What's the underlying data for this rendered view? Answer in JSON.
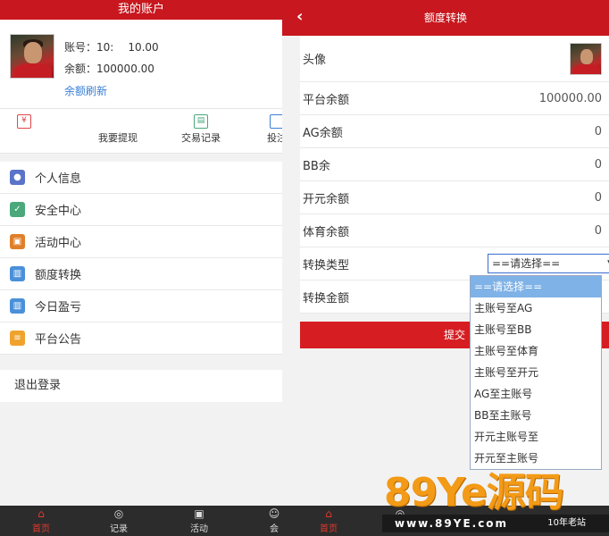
{
  "colors": {
    "brand_red": "#c8171e",
    "link_blue": "#3a7fd5",
    "footer_dark": "#2c2c2c",
    "dropdown_highlight": "#7fb2e6",
    "watermark_orange": "#f39a16"
  },
  "left": {
    "header_title": "我的账户",
    "account_label": "账号：",
    "account_value": "10:",
    "account_extra": "10.00",
    "balance_label": "余额：",
    "balance_value": "100000.00",
    "refresh_label": "余额刷新",
    "quick": [
      {
        "label": "",
        "icon": "arrow-icon"
      },
      {
        "label": "我要提现",
        "icon": "withdraw-icon"
      },
      {
        "label": "交易记录",
        "icon": "record-icon"
      },
      {
        "label": "投注",
        "icon": "bet-icon"
      }
    ],
    "menu": [
      {
        "label": "个人信息",
        "icon": "user-icon",
        "color": "#5a74c9"
      },
      {
        "label": "安全中心",
        "icon": "shield-icon",
        "color": "#4aa87b"
      },
      {
        "label": "活动中心",
        "icon": "gift-icon",
        "color": "#e07f2a"
      },
      {
        "label": "额度转换",
        "icon": "chart-icon",
        "color": "#4a90d9"
      },
      {
        "label": "今日盈亏",
        "icon": "bar-chart-icon",
        "color": "#4a90d9"
      },
      {
        "label": "平台公告",
        "icon": "notice-icon",
        "color": "#f0a32c"
      }
    ],
    "logout_label": "退出登录",
    "bottom_nav": [
      {
        "label": "首页",
        "icon": "home-icon"
      },
      {
        "label": "记录",
        "icon": "compass-icon"
      },
      {
        "label": "活动",
        "icon": "gift-icon"
      },
      {
        "label": "会",
        "icon": "user-icon"
      }
    ]
  },
  "right": {
    "header_title": "额度转换",
    "back_glyph": "‹",
    "rows": [
      {
        "label": "头像",
        "value": ""
      },
      {
        "label": "平台余额",
        "value": "100000.00"
      },
      {
        "label": "AG余额",
        "value": "0"
      },
      {
        "label": "BB余",
        "value": "0"
      },
      {
        "label": "开元余额",
        "value": "0"
      },
      {
        "label": "体育余额",
        "value": "0"
      }
    ],
    "transfer_type_label": "转换类型",
    "transfer_amount_label": "转换金额",
    "select_value": "==请选择==",
    "submit_label": "提交",
    "dropdown_options": [
      "==请选择==",
      "主账号至AG",
      "主账号至BB",
      "主账号至体育",
      "主账号至开元",
      "AG至主账号",
      "BB至主账号",
      "开元主账号至",
      "开元至主账号"
    ],
    "dropdown_selected_index": 0,
    "bottom_nav": [
      {
        "label": "首页",
        "icon": "home-icon"
      },
      {
        "label": "记录",
        "icon": "compass-icon"
      }
    ]
  },
  "watermark": {
    "main": "89Ye源码",
    "url": "www.89YE.com",
    "tag": "10年老站"
  }
}
